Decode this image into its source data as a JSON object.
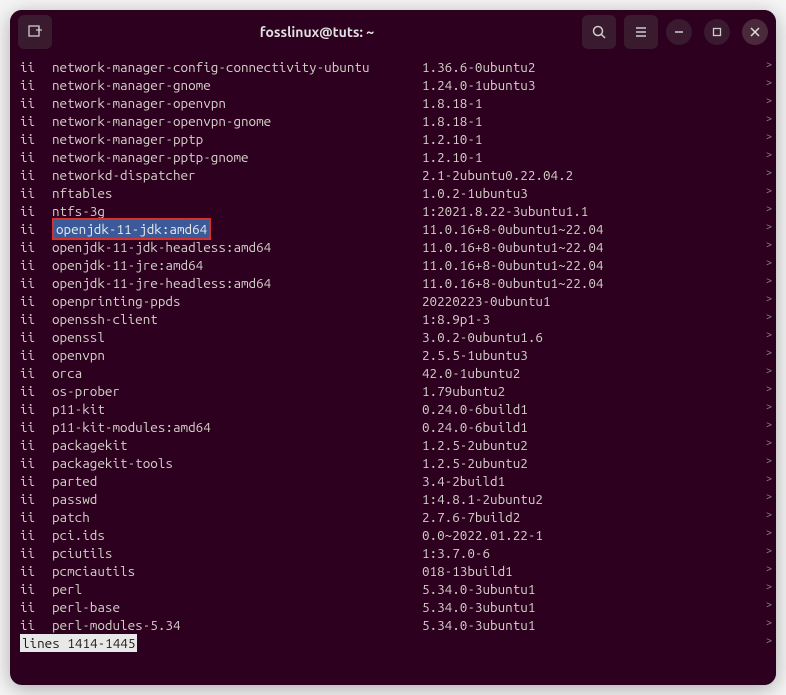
{
  "titlebar": {
    "title": "fosslinux@tuts: ~"
  },
  "packages": [
    {
      "status": "ii",
      "name": "network-manager-config-connectivity-ubuntu",
      "version": "1.36.6-0ubuntu2"
    },
    {
      "status": "ii",
      "name": "network-manager-gnome",
      "version": "1.24.0-1ubuntu3"
    },
    {
      "status": "ii",
      "name": "network-manager-openvpn",
      "version": "1.8.18-1"
    },
    {
      "status": "ii",
      "name": "network-manager-openvpn-gnome",
      "version": "1.8.18-1"
    },
    {
      "status": "ii",
      "name": "network-manager-pptp",
      "version": "1.2.10-1"
    },
    {
      "status": "ii",
      "name": "network-manager-pptp-gnome",
      "version": "1.2.10-1"
    },
    {
      "status": "ii",
      "name": "networkd-dispatcher",
      "version": "2.1-2ubuntu0.22.04.2"
    },
    {
      "status": "ii",
      "name": "nftables",
      "version": "1.0.2-1ubuntu3"
    },
    {
      "status": "ii",
      "name": "ntfs-3g",
      "version": "1:2021.8.22-3ubuntu1.1"
    },
    {
      "status": "ii",
      "name": "openjdk-11-jdk:amd64",
      "version": "11.0.16+8-0ubuntu1~22.04",
      "highlighted": true
    },
    {
      "status": "ii",
      "name": "openjdk-11-jdk-headless:amd64",
      "version": "11.0.16+8-0ubuntu1~22.04"
    },
    {
      "status": "ii",
      "name": "openjdk-11-jre:amd64",
      "version": "11.0.16+8-0ubuntu1~22.04"
    },
    {
      "status": "ii",
      "name": "openjdk-11-jre-headless:amd64",
      "version": "11.0.16+8-0ubuntu1~22.04"
    },
    {
      "status": "ii",
      "name": "openprinting-ppds",
      "version": "20220223-0ubuntu1"
    },
    {
      "status": "ii",
      "name": "openssh-client",
      "version": "1:8.9p1-3"
    },
    {
      "status": "ii",
      "name": "openssl",
      "version": "3.0.2-0ubuntu1.6"
    },
    {
      "status": "ii",
      "name": "openvpn",
      "version": "2.5.5-1ubuntu3"
    },
    {
      "status": "ii",
      "name": "orca",
      "version": "42.0-1ubuntu2"
    },
    {
      "status": "ii",
      "name": "os-prober",
      "version": "1.79ubuntu2"
    },
    {
      "status": "ii",
      "name": "p11-kit",
      "version": "0.24.0-6build1"
    },
    {
      "status": "ii",
      "name": "p11-kit-modules:amd64",
      "version": "0.24.0-6build1"
    },
    {
      "status": "ii",
      "name": "packagekit",
      "version": "1.2.5-2ubuntu2"
    },
    {
      "status": "ii",
      "name": "packagekit-tools",
      "version": "1.2.5-2ubuntu2"
    },
    {
      "status": "ii",
      "name": "parted",
      "version": "3.4-2build1"
    },
    {
      "status": "ii",
      "name": "passwd",
      "version": "1:4.8.1-2ubuntu2"
    },
    {
      "status": "ii",
      "name": "patch",
      "version": "2.7.6-7build2"
    },
    {
      "status": "ii",
      "name": "pci.ids",
      "version": "0.0~2022.01.22-1"
    },
    {
      "status": "ii",
      "name": "pciutils",
      "version": "1:3.7.0-6"
    },
    {
      "status": "ii",
      "name": "pcmciautils",
      "version": "018-13build1"
    },
    {
      "status": "ii",
      "name": "perl",
      "version": "5.34.0-3ubuntu1"
    },
    {
      "status": "ii",
      "name": "perl-base",
      "version": "5.34.0-3ubuntu1"
    },
    {
      "status": "ii",
      "name": "perl-modules-5.34",
      "version": "5.34.0-3ubuntu1"
    }
  ],
  "status_line": "lines 1414-1445",
  "scroll_arrow": ">"
}
